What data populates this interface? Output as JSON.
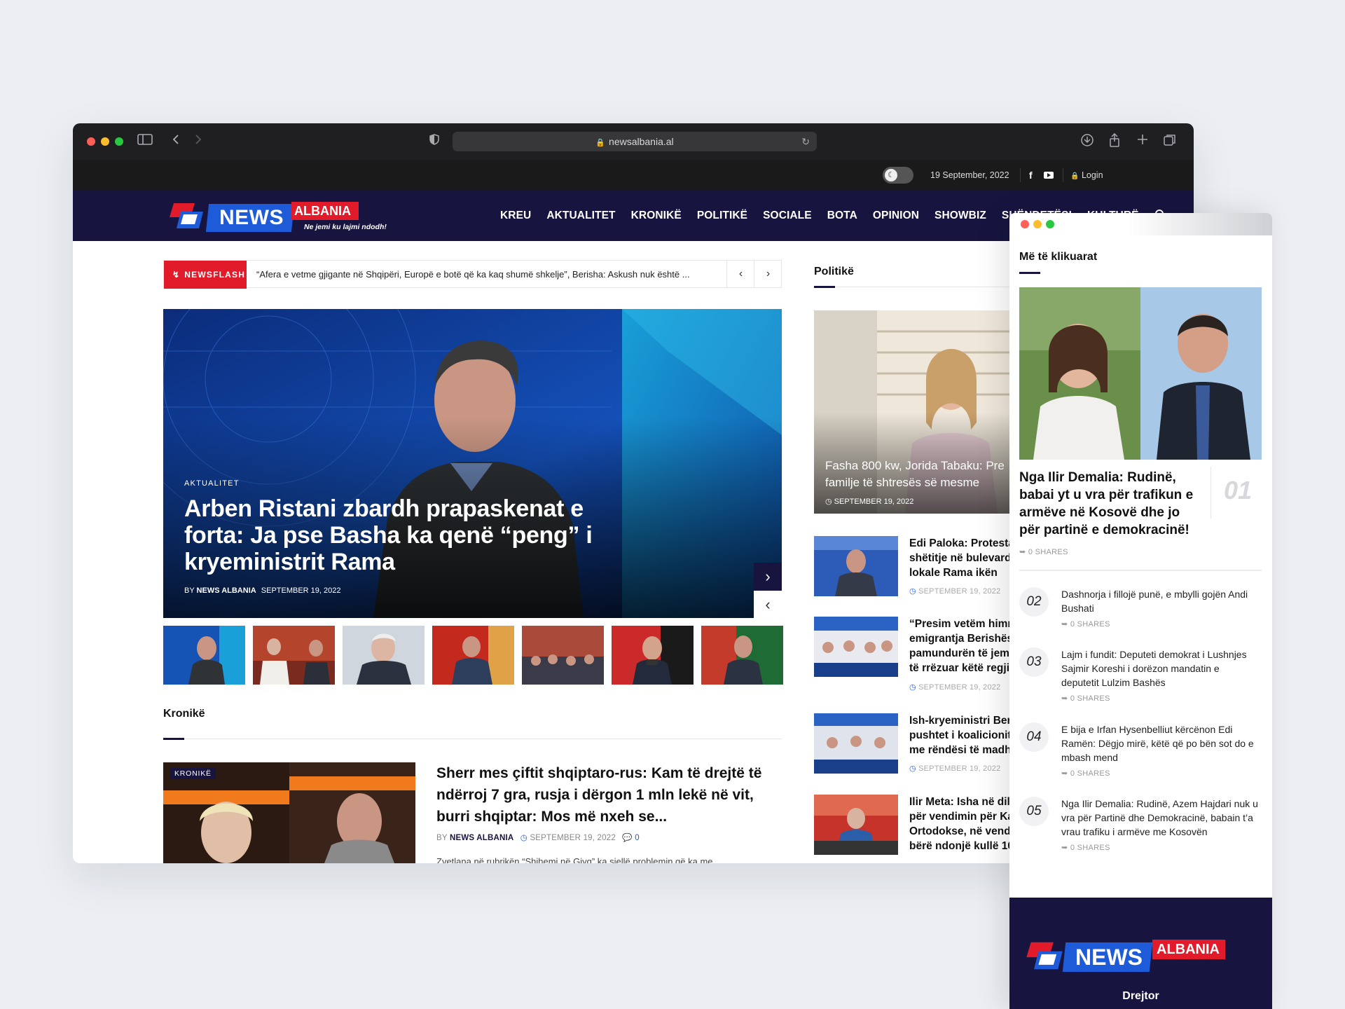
{
  "browser": {
    "url": "newsalbania.al"
  },
  "topbar": {
    "date": "19 September, 2022",
    "login": "Login"
  },
  "brand": {
    "news": "NEWS",
    "albania": "ALBANIA",
    "tagline": "Ne jemi ku lajmi ndodh!"
  },
  "nav": [
    "KREU",
    "AKTUALITET",
    "KRONIKË",
    "POLITIKË",
    "SOCIALE",
    "BOTA",
    "OPINION",
    "SHOWBIZ",
    "SHËNDETËSI",
    "KULTURË"
  ],
  "ticker": {
    "label": "NEWSFLASH",
    "text": "“Afera e vetme gjigante në Shqipëri, Europë e botë që ka kaq shumë shkelje”, Berisha: Askush nuk është ..."
  },
  "hero": {
    "category": "AKTUALITET",
    "title_lines": [
      "Arben Ristani zbardh prapaskenat e",
      "forta: Ja pse Basha ka qenë “peng” i",
      "kryeministrit Rama"
    ],
    "by": "BY",
    "author": "NEWS ALBANIA",
    "date": "SEPTEMBER 19, 2022"
  },
  "kronike": {
    "section": "Kronikë",
    "badge": "KRONIKË",
    "title_lines": [
      "Sherr mes çiftit shqiptaro-rus: Kam të drejtë të",
      "ndërroj 7 gra, rusja i dërgon 1 mln lekë në vit,",
      "burri shqiptar: Mos më nxeh se..."
    ],
    "by": "BY",
    "author": "NEWS ALBANIA",
    "date": "SEPTEMBER 19, 2022",
    "comments": "0",
    "excerpt": "Zvetlana në rubrikën “Shihemi në Gjyq” ka sjellë problemin që ka me..."
  },
  "politike": {
    "section": "Politikë",
    "featured": {
      "title_lines": [
        "Fasha 800 kw, Jorida Tabaku: Pre",
        "familje të shtresës së mesme"
      ],
      "date": "SEPTEMBER 19, 2022"
    },
    "items": [
      {
        "lines": [
          "Edi Paloka: Protesta",
          "shëtitje në bulevard",
          "lokale Rama ikën"
        ],
        "date": "SEPTEMBER 19, 2022"
      },
      {
        "lines": [
          "“Presim vetëm himn",
          "emigrantja Berishës",
          "pamundurën të jemi",
          "të rrëzuar këtë regji"
        ],
        "date": "SEPTEMBER 19, 2022"
      },
      {
        "lines": [
          "Ish-kryeministri Ber",
          "pushtet i koalicionit",
          "me rëndësi të madh"
        ],
        "date": "SEPTEMBER 19, 2022"
      },
      {
        "lines": [
          "Ilir Meta: Isha në dil",
          "për vendimin për Ka",
          "Ortodokse, në vend",
          "bërë ndonjë kullë 10"
        ],
        "date": "SEPTEMBER 19, 2022"
      }
    ]
  },
  "popup": {
    "section": "Më të klikuarat",
    "top": {
      "rank": "01",
      "title_lines": [
        "Nga Ilir Demalia: Rudinë,",
        "babai yt u vra për trafikun e",
        "armëve në Kosovë dhe jo",
        "për partinë e demokracinë!"
      ],
      "shares": "0 SHARES"
    },
    "items": [
      {
        "rank": "02",
        "lines": [
          "Dashnorja i fillojë punë, e mbylli gojën Andi",
          "Bushati"
        ],
        "shares": "0 SHARES"
      },
      {
        "rank": "03",
        "lines": [
          "Lajm i fundit: Deputeti demokrat i Lushnjes",
          "Sajmir Koreshi i dorëzon mandatin e",
          "deputetit Lulzim Bashës"
        ],
        "shares": "0 SHARES"
      },
      {
        "rank": "04",
        "lines": [
          "E bija e Irfan Hysenbelliut kërcënon Edi",
          "Ramën: Dëgjo mirë, këtë që po bën sot do e",
          "mbash mend"
        ],
        "shares": "0 SHARES"
      },
      {
        "rank": "05",
        "lines": [
          "Nga Ilir Demalia: Rudinë, Azem Hajdari nuk u",
          "vra për Partinë dhe Demokracinë, babain t’a",
          "vrau trafiku i armëve me Kosovën"
        ],
        "shares": "0 SHARES"
      }
    ],
    "footer": {
      "news": "NEWS",
      "albania": "ALBANIA",
      "role": "Drejtor"
    }
  },
  "colors": {
    "navy": "#171540",
    "red": "#e11b2a",
    "blue": "#1e5bd8"
  }
}
